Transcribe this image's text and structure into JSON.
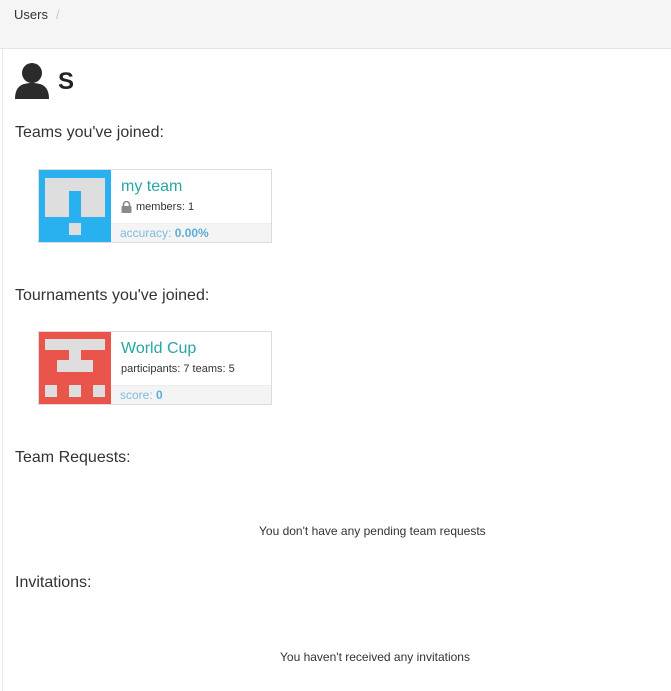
{
  "breadcrumb": {
    "current": "Users",
    "separator": "/"
  },
  "user": {
    "name": "S",
    "avatar_icon": "user-silhouette-icon"
  },
  "teams_section": {
    "title": "Teams you've joined:",
    "items": [
      {
        "name": "my team",
        "members_label": "members: 1",
        "lock_icon": "lock-icon",
        "accuracy_label": "accuracy:",
        "accuracy_value": "0.00%",
        "icon_color": "#29b0ee"
      }
    ]
  },
  "tournaments_section": {
    "title": "Tournaments you've joined:",
    "items": [
      {
        "name": "World Cup",
        "meta_label": "participants: 7 teams: 5",
        "score_label": "score:",
        "score_value": "0",
        "icon_color": "#e9554a"
      }
    ]
  },
  "team_requests_section": {
    "title": "Team Requests:",
    "empty_message": "You don't have any pending team requests"
  },
  "invitations_section": {
    "title": "Invitations:",
    "empty_message": "You haven't received any invitations"
  }
}
